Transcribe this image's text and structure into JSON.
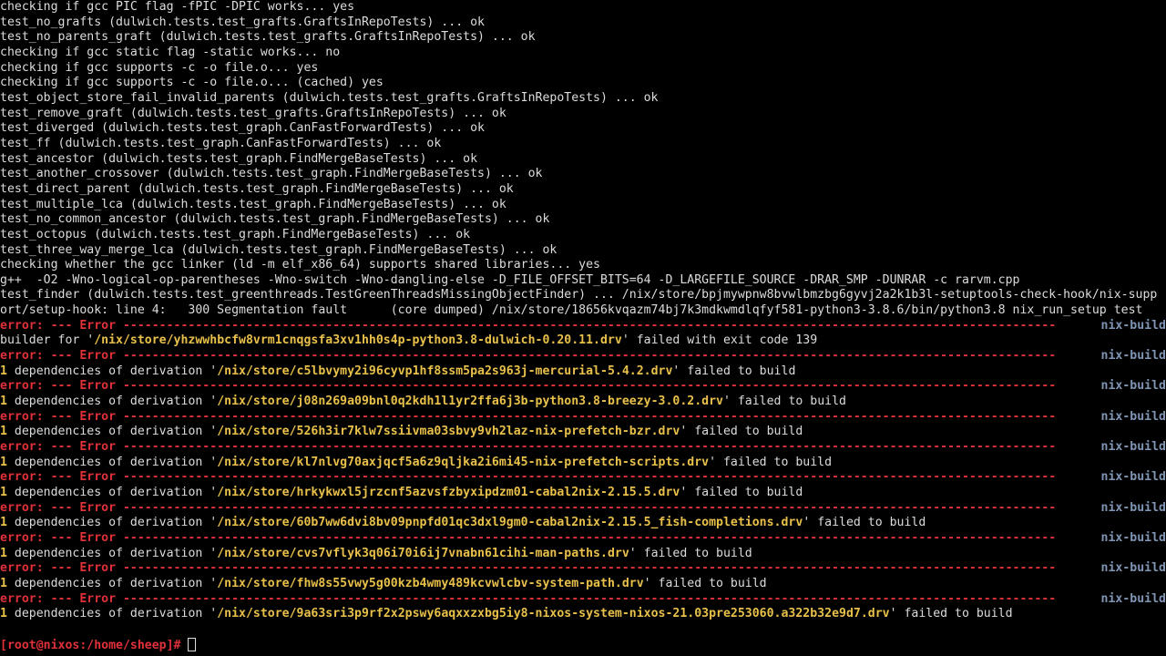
{
  "terminal": {
    "plain_lines": [
      "checking if gcc PIC flag -fPIC -DPIC works... yes",
      "test_no_grafts (dulwich.tests.test_grafts.GraftsInRepoTests) ... ok",
      "test_no_parents_graft (dulwich.tests.test_grafts.GraftsInRepoTests) ... ok",
      "checking if gcc static flag -static works... no",
      "checking if gcc supports -c -o file.o... yes",
      "checking if gcc supports -c -o file.o... (cached) yes",
      "test_object_store_fail_invalid_parents (dulwich.tests.test_grafts.GraftsInRepoTests) ... ok",
      "test_remove_graft (dulwich.tests.test_grafts.GraftsInRepoTests) ... ok",
      "test_diverged (dulwich.tests.test_graph.CanFastForwardTests) ... ok",
      "test_ff (dulwich.tests.test_graph.CanFastForwardTests) ... ok",
      "test_ancestor (dulwich.tests.test_graph.FindMergeBaseTests) ... ok",
      "test_another_crossover (dulwich.tests.test_graph.FindMergeBaseTests) ... ok",
      "test_direct_parent (dulwich.tests.test_graph.FindMergeBaseTests) ... ok",
      "test_multiple_lca (dulwich.tests.test_graph.FindMergeBaseTests) ... ok",
      "test_no_common_ancestor (dulwich.tests.test_graph.FindMergeBaseTests) ... ok",
      "test_octopus (dulwich.tests.test_graph.FindMergeBaseTests) ... ok",
      "test_three_way_merge_lca (dulwich.tests.test_graph.FindMergeBaseTests) ... ok",
      "checking whether the gcc linker (ld -m elf_x86_64) supports shared libraries... yes",
      "g++  -O2 -Wno-logical-op-parentheses -Wno-switch -Wno-dangling-else -D_FILE_OFFSET_BITS=64 -D_LARGEFILE_SOURCE -DRAR_SMP -DUNRAR -c rarvm.cpp",
      "test_finder (dulwich.tests.test_greenthreads.TestGreenThreadsMissingObjectFinder) ... /nix/store/bpjmywpnw8bvwlbmzbg6gyvj2a2k1b3l-setuptools-check-hook/nix-supp",
      "ort/setup-hook: line 4:   300 Segmentation fault      (core dumped) /nix/store/18656kvqazm74bj7k3mdkwmdlqfyf581-python3-3.8.6/bin/python3.8 nix_run_setup test"
    ],
    "error_header": {
      "label": "error:",
      "text": " --- Error ---------------------------------------------------------------------------------------------------------------------------------",
      "tag": "nix-build"
    },
    "builder_line": {
      "prefix": "builder for '",
      "path": "/nix/store/yhzwwhbcfw8vrm1cnqgsfa3xv1hh0s4p-python3.8-dulwich-0.20.11.drv",
      "suffix": "' failed with exit code 139"
    },
    "dependency_lines": [
      {
        "count": "1",
        "prefix": " dependencies of derivation '",
        "path": "/nix/store/c5lbvymy2i96cyvp1hf8ssm5pa2s963j-mercurial-5.4.2.drv",
        "suffix": "' failed to build"
      },
      {
        "count": "1",
        "prefix": " dependencies of derivation '",
        "path": "/nix/store/j08n269a09bnl0q2kdh1l1yr2ffa6j3b-python3.8-breezy-3.0.2.drv",
        "suffix": "' failed to build"
      },
      {
        "count": "1",
        "prefix": " dependencies of derivation '",
        "path": "/nix/store/526h3ir7klw7ssiivma03sbvy9vh2laz-nix-prefetch-bzr.drv",
        "suffix": "' failed to build"
      },
      {
        "count": "1",
        "prefix": " dependencies of derivation '",
        "path": "/nix/store/kl7nlvg70axjqcf5a6z9qljka2i6mi45-nix-prefetch-scripts.drv",
        "suffix": "' failed to build"
      },
      {
        "count": "1",
        "prefix": " dependencies of derivation '",
        "path": "/nix/store/hrkykwxl5jrzcnf5azvsfzbyxipdzm01-cabal2nix-2.15.5.drv",
        "suffix": "' failed to build"
      },
      {
        "count": "1",
        "prefix": " dependencies of derivation '",
        "path": "/nix/store/60b7ww6dvi8bv09pnpfd01qc3dxl9gm0-cabal2nix-2.15.5_fish-completions.drv",
        "suffix": "' failed to build"
      },
      {
        "count": "1",
        "prefix": " dependencies of derivation '",
        "path": "/nix/store/cvs7vflyk3q06i70i6ij7vnabn61cihi-man-paths.drv",
        "suffix": "' failed to build"
      },
      {
        "count": "1",
        "prefix": " dependencies of derivation '",
        "path": "/nix/store/fhw8s55vwy5g00kzb4wmy489kcvwlcbv-system-path.drv",
        "suffix": "' failed to build"
      },
      {
        "count": "1",
        "prefix": " dependencies of derivation '",
        "path": "/nix/store/9a63sri3p9rf2x2pswy6aqxxzxbg5iy8-nixos-system-nixos-21.03pre253060.a322b32e9d7.drv",
        "suffix": "' failed to build"
      }
    ],
    "prompt": "[root@nixos:/home/sheep]#",
    "colors": {
      "background": "#000000",
      "foreground": "#dcdcdc",
      "error": "#e0303a",
      "path": "#e8c04a",
      "tag": "#7f95b3"
    }
  }
}
